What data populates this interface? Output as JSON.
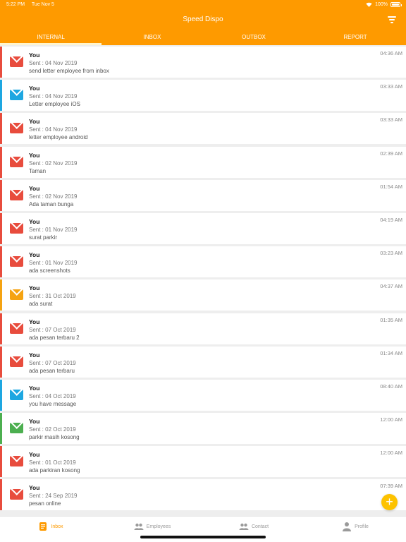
{
  "status": {
    "time": "5:22 PM",
    "date": "Tue Nov 5",
    "battery": "100%"
  },
  "header": {
    "title": "Speed Dispo"
  },
  "tabs": [
    {
      "label": "INTERNAL",
      "active": true
    },
    {
      "label": "INBOX",
      "active": false
    },
    {
      "label": "OUTBOX",
      "active": false
    },
    {
      "label": "REPORT",
      "active": false
    }
  ],
  "colors": {
    "accent": "#fe9a00",
    "red": "#e84c3d",
    "blue": "#1ea7e1",
    "orange": "#f5a312",
    "green": "#4caf50",
    "fab": "#fdc200"
  },
  "messages": [
    {
      "sender": "You",
      "sent": "Sent : 04 Nov 2019",
      "subject": "send letter employee from inbox",
      "time": "04:36 AM",
      "color": "red"
    },
    {
      "sender": "You",
      "sent": "Sent : 04 Nov 2019",
      "subject": "Letter employee iOS",
      "time": "03:33 AM",
      "color": "blue"
    },
    {
      "sender": "You",
      "sent": "Sent : 04 Nov 2019",
      "subject": "letter employee android",
      "time": "03:33 AM",
      "color": "red"
    },
    {
      "sender": "You",
      "sent": "Sent : 02 Nov 2019",
      "subject": "Taman",
      "time": "02:39 AM",
      "color": "red"
    },
    {
      "sender": "You",
      "sent": "Sent : 02 Nov 2019",
      "subject": "Ada taman bunga",
      "time": "01:54 AM",
      "color": "red"
    },
    {
      "sender": "You",
      "sent": "Sent : 01 Nov 2019",
      "subject": "surat parkir",
      "time": "04:19 AM",
      "color": "red"
    },
    {
      "sender": "You",
      "sent": "Sent : 01 Nov 2019",
      "subject": "ada screenshots",
      "time": "03:23 AM",
      "color": "red"
    },
    {
      "sender": "You",
      "sent": "Sent : 31 Oct 2019",
      "subject": "ada surat",
      "time": "04:37 AM",
      "color": "orange"
    },
    {
      "sender": "You",
      "sent": "Sent : 07 Oct 2019",
      "subject": "ada pesan terbaru 2",
      "time": "01:35 AM",
      "color": "red"
    },
    {
      "sender": "You",
      "sent": "Sent : 07 Oct 2019",
      "subject": "ada pesan terbaru",
      "time": "01:34 AM",
      "color": "red"
    },
    {
      "sender": "You",
      "sent": "Sent : 04 Oct 2019",
      "subject": "you have message",
      "time": "08:40 AM",
      "color": "blue"
    },
    {
      "sender": "You",
      "sent": "Sent : 02 Oct 2019",
      "subject": "parkir masih kosong",
      "time": "12:00 AM",
      "color": "green"
    },
    {
      "sender": "You",
      "sent": "Sent : 01 Oct 2019",
      "subject": "ada parkiran kosong",
      "time": "12:00 AM",
      "color": "red"
    },
    {
      "sender": "You",
      "sent": "Sent : 24 Sep 2019",
      "subject": "pesan online",
      "time": "07:39 AM",
      "color": "red"
    }
  ],
  "fab": {
    "label": "+"
  },
  "bottom_nav": [
    {
      "label": "Inbox",
      "icon": "inbox-icon",
      "active": true
    },
    {
      "label": "Employees",
      "icon": "people-icon",
      "active": false
    },
    {
      "label": "Contact",
      "icon": "contact-icon",
      "active": false
    },
    {
      "label": "Profile",
      "icon": "person-icon",
      "active": false
    }
  ]
}
